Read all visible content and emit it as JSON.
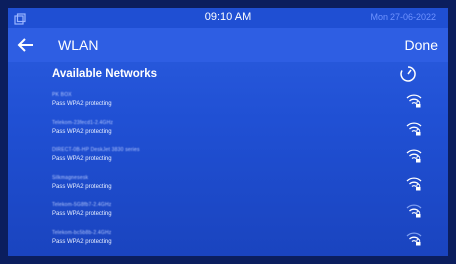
{
  "status_bar": {
    "time": "09:10 AM",
    "day": "Mon",
    "date": "27-06-2022",
    "left_icon": "window-icon"
  },
  "header": {
    "back_icon": "back-arrow-icon",
    "title": "WLAN",
    "done_label": "Done"
  },
  "section": {
    "title": "Available Networks",
    "refresh_icon": "refresh-icon"
  },
  "networks": [
    {
      "name": "PK BOX",
      "status": "Pass WPA2 protecting",
      "icon": "wifi-lock-icon",
      "strength": "strong"
    },
    {
      "name": "Telekom-23fecd1-2.4GHz",
      "status": "Pass WPA2 protecting",
      "icon": "wifi-lock-icon",
      "strength": "strong"
    },
    {
      "name": "DIRECT-0B-HP DeskJet 3830 series",
      "status": "Pass WPA2 protecting",
      "icon": "wifi-lock-icon",
      "strength": "strong"
    },
    {
      "name": "Silkmagnesesk",
      "status": "Pass WPA2 protecting",
      "icon": "wifi-lock-icon",
      "strength": "strong"
    },
    {
      "name": "Telekom-5G8fb7-2.4GHz",
      "status": "Pass WPA2 protecting",
      "icon": "wifi-lock-icon",
      "strength": "medium"
    },
    {
      "name": "Telekom-bc5b8b-2.4GHz",
      "status": "Pass WPA2 protecting",
      "icon": "wifi-lock-icon",
      "strength": "medium"
    }
  ],
  "colors": {
    "background": "#2356d9",
    "status_bar": "#1f4fd3",
    "date_text": "#6f93ff"
  }
}
